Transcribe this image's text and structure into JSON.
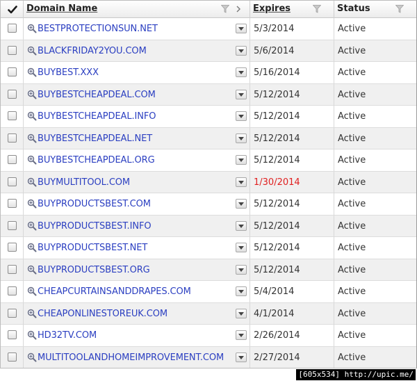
{
  "header": {
    "domain_label": "Domain Name",
    "expires_label": "Expires",
    "status_label": "Status"
  },
  "rows": [
    {
      "domain": "BESTPROTECTIONSUN.NET",
      "expires": "5/3/2014",
      "status": "Active",
      "expired": false
    },
    {
      "domain": "BLACKFRIDAY2YOU.COM",
      "expires": "5/6/2014",
      "status": "Active",
      "expired": false
    },
    {
      "domain": "BUYBEST.XXX",
      "expires": "5/16/2014",
      "status": "Active",
      "expired": false
    },
    {
      "domain": "BUYBESTCHEAPDEAL.COM",
      "expires": "5/12/2014",
      "status": "Active",
      "expired": false
    },
    {
      "domain": "BUYBESTCHEAPDEAL.INFO",
      "expires": "5/12/2014",
      "status": "Active",
      "expired": false
    },
    {
      "domain": "BUYBESTCHEAPDEAL.NET",
      "expires": "5/12/2014",
      "status": "Active",
      "expired": false
    },
    {
      "domain": "BUYBESTCHEAPDEAL.ORG",
      "expires": "5/12/2014",
      "status": "Active",
      "expired": false
    },
    {
      "domain": "BUYMULTITOOL.COM",
      "expires": "1/30/2014",
      "status": "Active",
      "expired": true
    },
    {
      "domain": "BUYPRODUCTSBEST.COM",
      "expires": "5/12/2014",
      "status": "Active",
      "expired": false
    },
    {
      "domain": "BUYPRODUCTSBEST.INFO",
      "expires": "5/12/2014",
      "status": "Active",
      "expired": false
    },
    {
      "domain": "BUYPRODUCTSBEST.NET",
      "expires": "5/12/2014",
      "status": "Active",
      "expired": false
    },
    {
      "domain": "BUYPRODUCTSBEST.ORG",
      "expires": "5/12/2014",
      "status": "Active",
      "expired": false
    },
    {
      "domain": "CHEAPCURTAINSANDDRAPES.COM",
      "expires": "5/4/2014",
      "status": "Active",
      "expired": false
    },
    {
      "domain": "CHEAPONLINESTOREUK.COM",
      "expires": "4/1/2014",
      "status": "Active",
      "expired": false
    },
    {
      "domain": "HD32TV.COM",
      "expires": "2/26/2014",
      "status": "Active",
      "expired": false
    },
    {
      "domain": "MULTITOOLANDHOMEIMPROVEMENT.COM",
      "expires": "2/27/2014",
      "status": "Active",
      "expired": false
    }
  ],
  "colors": {
    "link": "#2b3fc1",
    "expired": "#e02020",
    "row_alt": "#f0f0f0"
  },
  "watermark": "[605x534] http://upic.me/"
}
